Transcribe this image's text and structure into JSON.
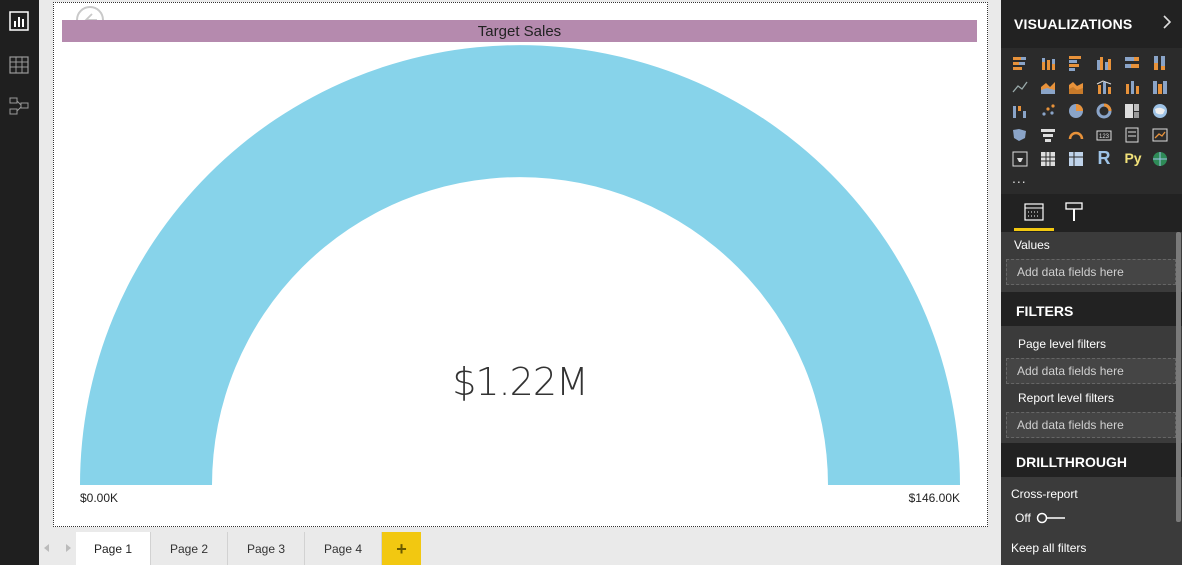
{
  "visual": {
    "title": "Target Sales",
    "value": "$1.22M",
    "min_label": "$0.00K",
    "max_label": "$146.00K",
    "title_bg_color": "#b58aae",
    "gauge_color": "#87d3ea"
  },
  "pages": {
    "tabs": [
      "Page 1",
      "Page 2",
      "Page 3",
      "Page 4"
    ],
    "active": "Page 1",
    "add_label": "+"
  },
  "visualizations": {
    "title": "VISUALIZATIONS",
    "expand_icon": "chevron-right-icon",
    "more_label": "..."
  },
  "fields_pane": {
    "values_label": "Values",
    "values_placeholder": "Add data fields here"
  },
  "filters": {
    "title": "FILTERS",
    "page_level_label": "Page level filters",
    "page_level_placeholder": "Add data fields here",
    "report_level_label": "Report level filters",
    "report_level_placeholder": "Add data fields here"
  },
  "drillthrough": {
    "title": "DRILLTHROUGH",
    "cross_report_label": "Cross-report",
    "cross_report_state": "Off",
    "keep_filters_label": "Keep all filters"
  },
  "viz_icons": {
    "r_label": "R",
    "py_label": "Py"
  },
  "accent_color": "#f2c811"
}
